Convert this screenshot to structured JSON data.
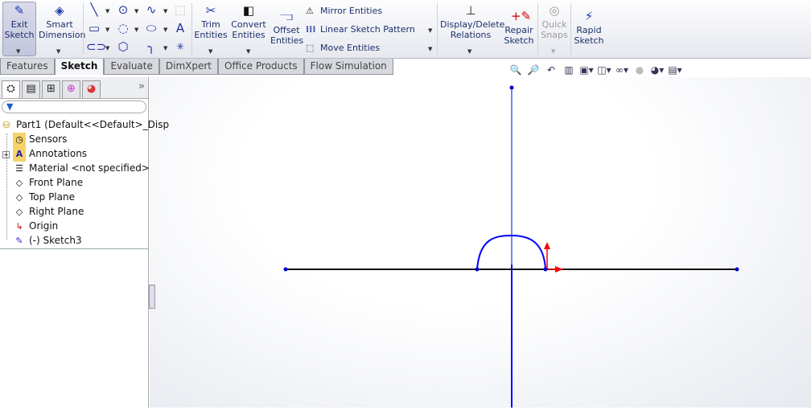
{
  "ribbon": {
    "exit_sketch": "Exit\nSketch",
    "exit_l1": "Exit",
    "exit_l2": "Sketch",
    "smart_l1": "Smart",
    "smart_l2": "Dimension",
    "trim_l1": "Trim",
    "trim_l2": "Entities",
    "convert_l1": "Convert",
    "convert_l2": "Entities",
    "offset_l1": "Offset",
    "offset_l2": "Entities",
    "mirror": "Mirror Entities",
    "linear_pattern": "Linear Sketch Pattern",
    "move": "Move Entities",
    "display_l1": "Display/Delete",
    "display_l2": "Relations",
    "repair_l1": "Repair",
    "repair_l2": "Sketch",
    "quick_l1": "Quick",
    "quick_l2": "Snaps",
    "rapid_l1": "Rapid",
    "rapid_l2": "Sketch"
  },
  "tabs": [
    {
      "label": "Features"
    },
    {
      "label": "Sketch"
    },
    {
      "label": "Evaluate"
    },
    {
      "label": "DimXpert"
    },
    {
      "label": "Office Products"
    },
    {
      "label": "Flow Simulation"
    }
  ],
  "active_tab": "Sketch",
  "tree": {
    "items": [
      {
        "label": "Part1  (Default<<Default>_Disp"
      },
      {
        "label": "Sensors"
      },
      {
        "label": "Annotations"
      },
      {
        "label": "Material <not specified>"
      },
      {
        "label": "Front Plane"
      },
      {
        "label": "Top Plane"
      },
      {
        "label": "Right Plane"
      },
      {
        "label": "Origin"
      },
      {
        "label": "(-) Sketch3"
      }
    ]
  },
  "colors": {
    "sketch_line": "#0000ff",
    "construction_line": "#000000",
    "origin_arrow": "#ff0000",
    "accent": "#1c2f6a"
  }
}
